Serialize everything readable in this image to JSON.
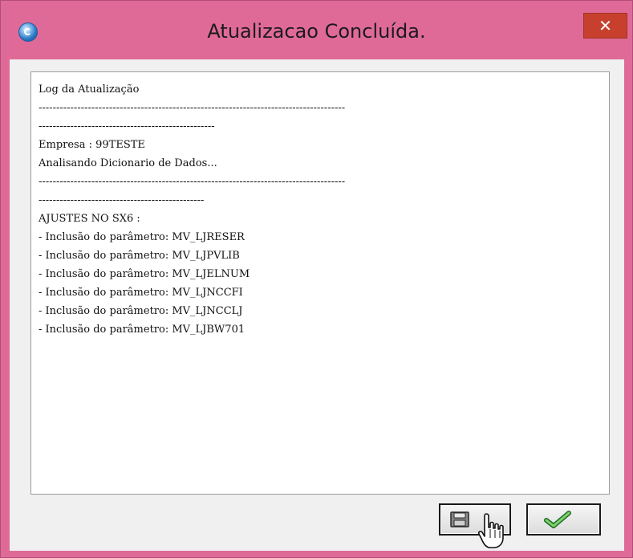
{
  "window": {
    "title": "Atualizacao Concluída.",
    "close_glyph": "✕"
  },
  "log": {
    "lines": [
      "Log da Atualização",
      "---------------------------------------------------------------------------------------",
      "--------------------------------------------------",
      "Empresa : 99TESTE",
      "Analisando Dicionario de Dados...",
      "---------------------------------------------------------------------------------------",
      "-----------------------------------------------",
      "AJUSTES NO SX6 :",
      "- Inclusão do parâmetro: MV_LJRESER",
      "- Inclusão do parâmetro: MV_LJPVLIB",
      "- Inclusão do parâmetro: MV_LJELNUM",
      "- Inclusão do parâmetro: MV_LJNCCFI",
      "- Inclusão do parâmetro: MV_LJNCCLJ",
      "- Inclusão do parâmetro: MV_LJBW701"
    ]
  },
  "buttons": {
    "save_icon": "floppy-disk-icon",
    "ok_icon": "checkmark-icon"
  },
  "colors": {
    "frame": "#df6a98",
    "close": "#c7402e",
    "client": "#f0f0f0",
    "check": "#3aa845"
  }
}
